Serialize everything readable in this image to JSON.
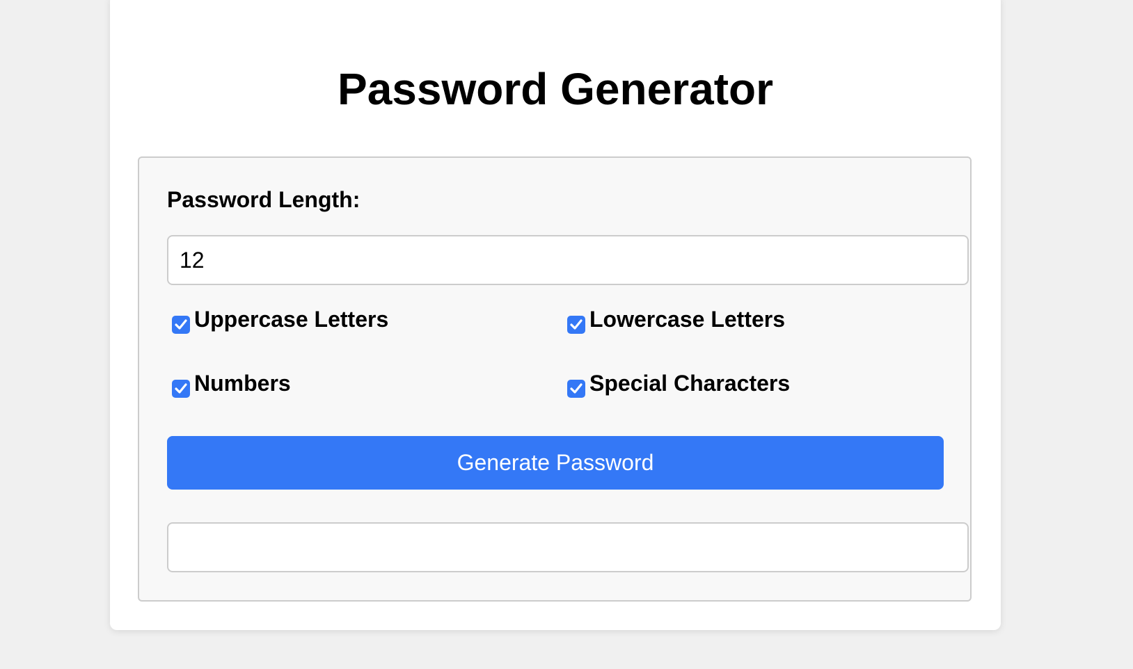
{
  "title": "Password Generator",
  "length": {
    "label": "Password Length:",
    "value": "12"
  },
  "options": [
    {
      "label": "Uppercase Letters",
      "checked": true
    },
    {
      "label": "Lowercase Letters",
      "checked": true
    },
    {
      "label": "Numbers",
      "checked": true
    },
    {
      "label": "Special Characters",
      "checked": true
    }
  ],
  "generate_button": {
    "label": "Generate Password"
  },
  "result": {
    "value": ""
  },
  "colors": {
    "accent": "#3478f6",
    "background": "#f0f0f0",
    "card": "#ffffff",
    "panel": "#f8f8f8",
    "border": "#cccccc"
  },
  "icons": {
    "checkbox": "checkmark-icon"
  }
}
